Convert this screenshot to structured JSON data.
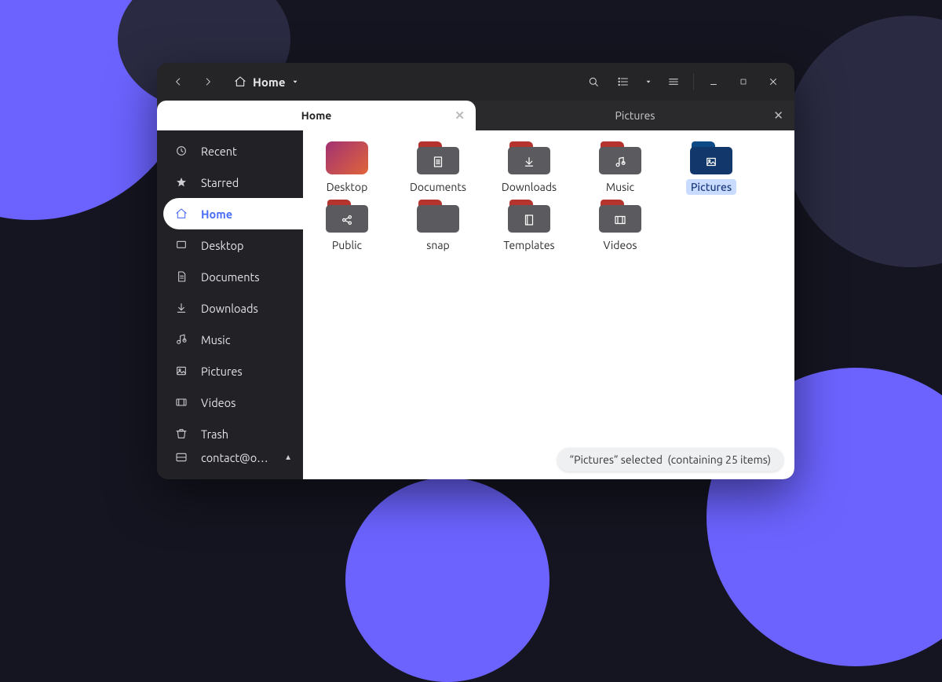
{
  "breadcrumb": {
    "location": "Home"
  },
  "tabs": [
    {
      "label": "Home",
      "active": true
    },
    {
      "label": "Pictures",
      "active": false
    }
  ],
  "sidebar": {
    "items": [
      {
        "icon": "clock",
        "label": "Recent"
      },
      {
        "icon": "star",
        "label": "Starred"
      },
      {
        "icon": "home",
        "label": "Home",
        "active": true
      },
      {
        "icon": "desktop",
        "label": "Desktop"
      },
      {
        "icon": "documents",
        "label": "Documents"
      },
      {
        "icon": "downloads",
        "label": "Downloads"
      },
      {
        "icon": "music",
        "label": "Music"
      },
      {
        "icon": "pictures",
        "label": "Pictures"
      },
      {
        "icon": "videos",
        "label": "Videos"
      },
      {
        "icon": "trash",
        "label": "Trash"
      }
    ],
    "mount": {
      "icon": "disk",
      "label": "contact@o…"
    }
  },
  "files": [
    {
      "name": "Desktop",
      "type": "desktop"
    },
    {
      "name": "Documents",
      "type": "folder",
      "glyph": "doc"
    },
    {
      "name": "Downloads",
      "type": "folder",
      "glyph": "down"
    },
    {
      "name": "Music",
      "type": "folder",
      "glyph": "music"
    },
    {
      "name": "Pictures",
      "type": "folder",
      "glyph": "image",
      "selected": true
    },
    {
      "name": "Public",
      "type": "folder",
      "glyph": "share"
    },
    {
      "name": "snap",
      "type": "folder",
      "glyph": ""
    },
    {
      "name": "Templates",
      "type": "folder",
      "glyph": "template"
    },
    {
      "name": "Videos",
      "type": "folder",
      "glyph": "video"
    }
  ],
  "status": {
    "selected_name": "Pictures",
    "count_label": "(containing 25 items)",
    "selected_word": "selected"
  }
}
